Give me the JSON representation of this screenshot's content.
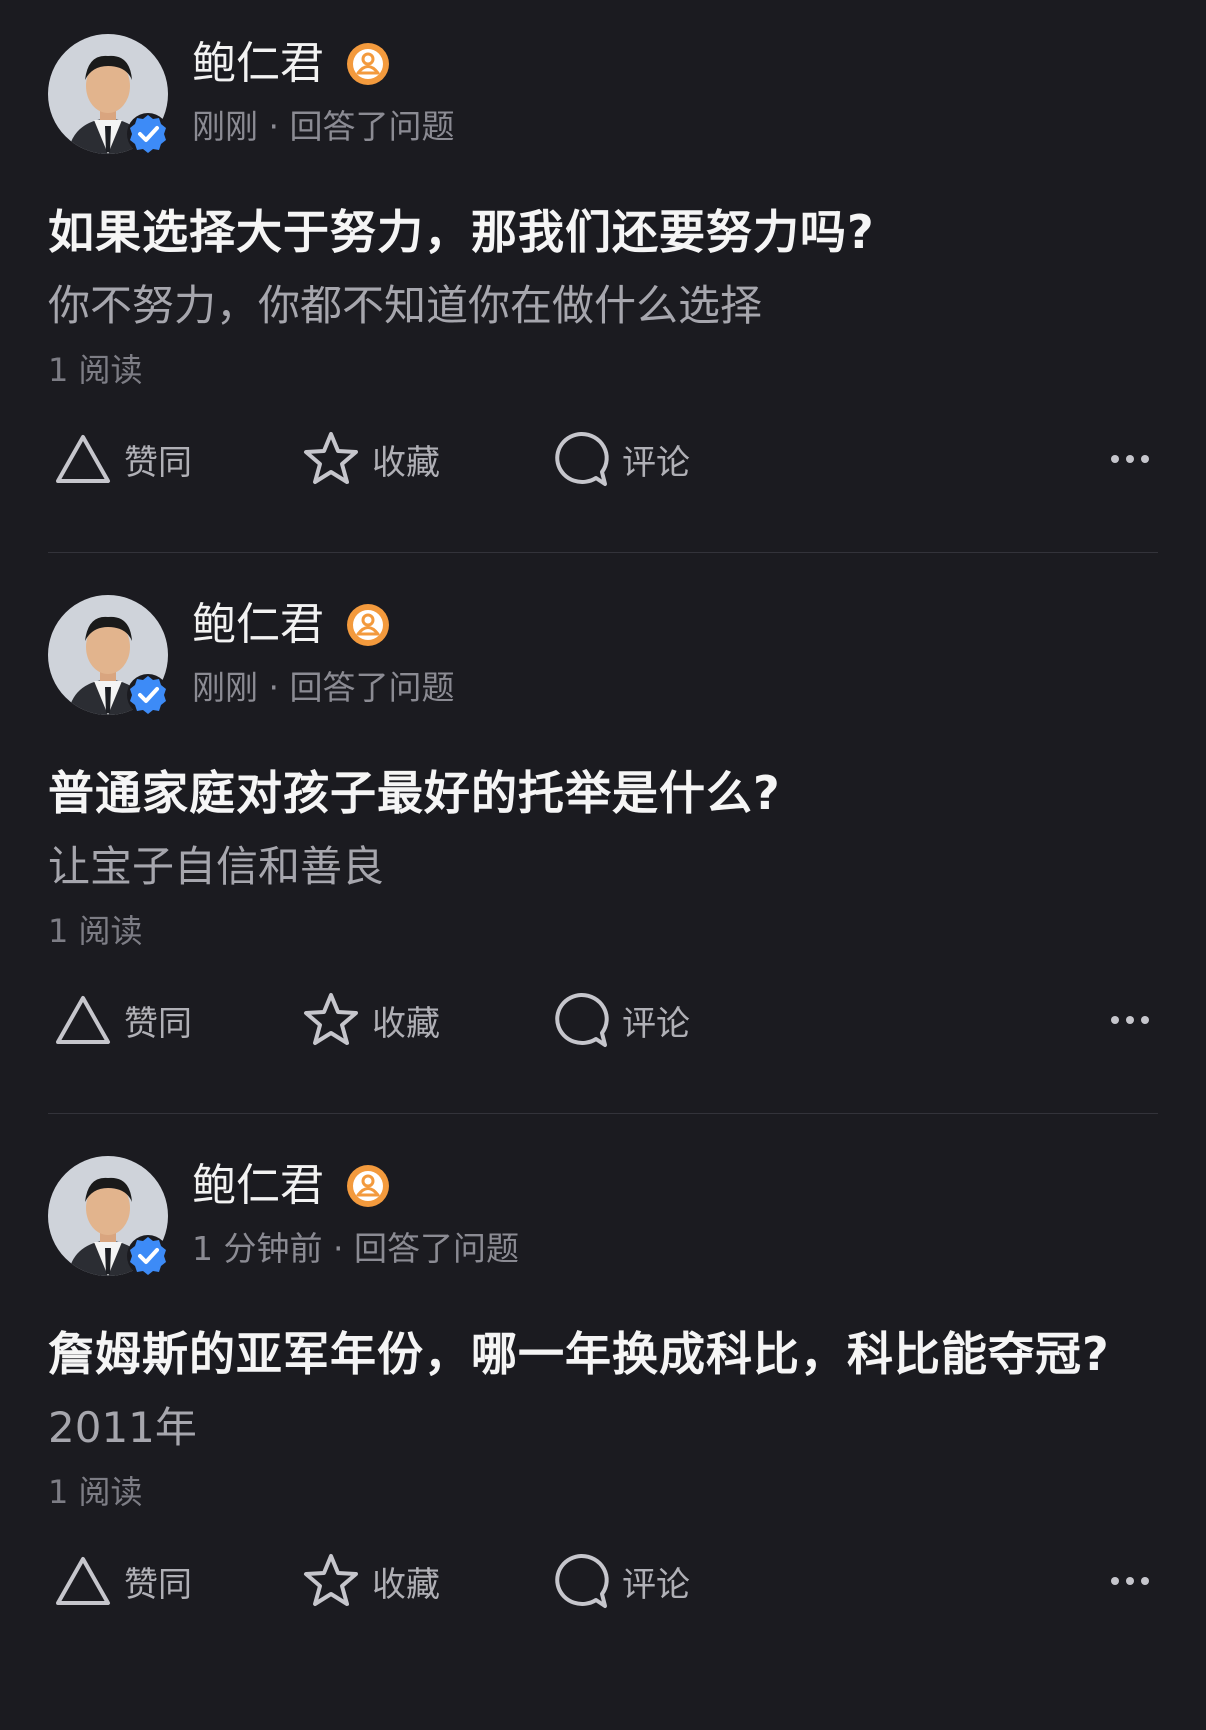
{
  "posts": [
    {
      "author": "鲍仁君",
      "meta": "刚刚 · 回答了问题",
      "question": "如果选择大于努力，那我们还要努力吗?",
      "answer": "你不努力，你都不知道你在做什么选择",
      "reads": "1  阅读",
      "actions": {
        "like": "赞同",
        "collect": "收藏",
        "comment": "评论"
      }
    },
    {
      "author": "鲍仁君",
      "meta": "刚刚 · 回答了问题",
      "question": "普通家庭对孩子最好的托举是什么?",
      "answer": "让宝子自信和善良",
      "reads": "1  阅读",
      "actions": {
        "like": "赞同",
        "collect": "收藏",
        "comment": "评论"
      }
    },
    {
      "author": "鲍仁君",
      "meta": "1 分钟前 · 回答了问题",
      "question": "詹姆斯的亚军年份，哪一年换成科比，科比能夺冠?",
      "answer": "2011年",
      "reads": "1  阅读",
      "actions": {
        "like": "赞同",
        "collect": "收藏",
        "comment": "评论"
      }
    }
  ],
  "icons": {
    "verified": "verified-check-icon",
    "badge": "user-badge-icon",
    "like": "upvote-triangle-icon",
    "collect": "star-icon",
    "comment": "comment-bubble-icon",
    "more": "more-dots-icon"
  },
  "colors": {
    "background": "#1b1b20",
    "verified": "#3d8bf7",
    "badge": "#f39a3d"
  }
}
